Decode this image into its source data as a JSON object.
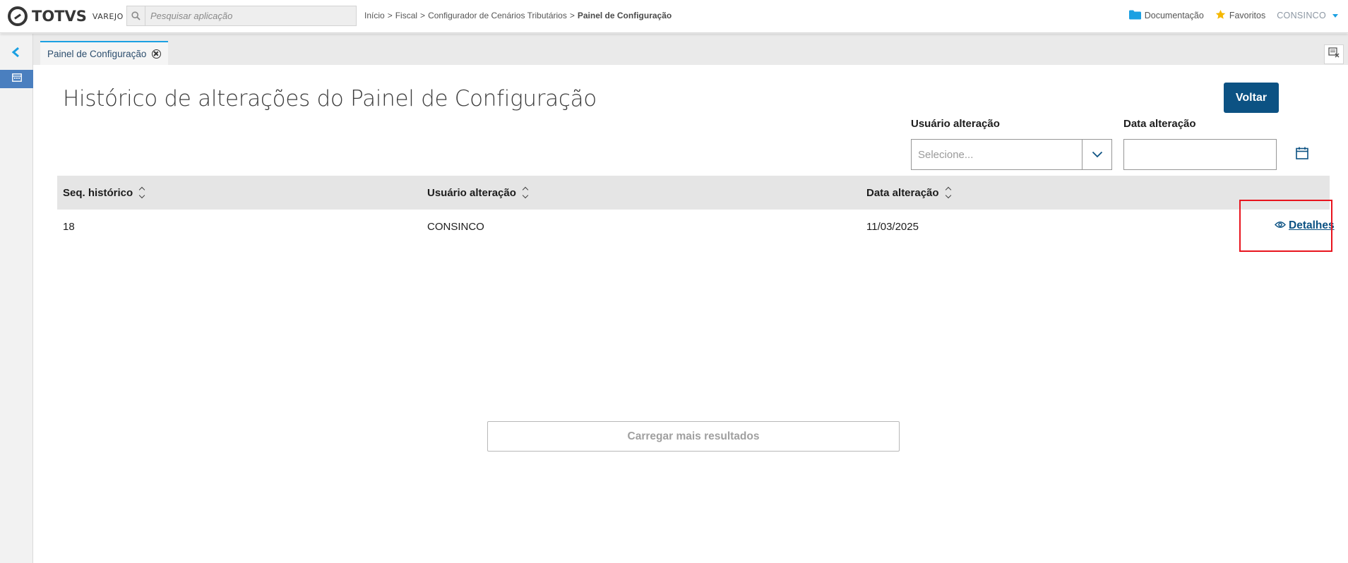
{
  "header": {
    "logo_text": "TOTVS",
    "logo_sub": "VAREJO",
    "search_placeholder": "Pesquisar aplicação",
    "breadcrumb": [
      "Início",
      "Fiscal",
      "Configurador de Cenários Tributários"
    ],
    "breadcrumb_current": "Painel de Configuração",
    "breadcrumb_separator": ">",
    "documentation_label": "Documentação",
    "favorites_label": "Favoritos",
    "user_label": "CONSINCO",
    "icons": {
      "search": "search-icon",
      "documentation": "folder-icon",
      "favorites": "star-icon",
      "user_menu": "caret-down-icon"
    }
  },
  "sidebar": {
    "toggle_icon": "chevron-left-icon",
    "active_item_icon": "calendar-grid-icon"
  },
  "tabs": [
    {
      "label": "Painel de Configuração",
      "active": true
    }
  ],
  "page": {
    "title": "Histórico de alterações do Painel de Configuração",
    "back_button": "Voltar",
    "filters": {
      "user_label": "Usuário alteração",
      "user_placeholder": "Selecione...",
      "date_label": "Data alteração",
      "date_value": ""
    },
    "table": {
      "columns": [
        "Seq. histórico",
        "Usuário alteração",
        "Data alteração"
      ],
      "rows": [
        {
          "seq": "18",
          "user": "CONSINCO",
          "date": "11/03/2025",
          "action": "Detalhes"
        }
      ]
    },
    "load_more": "Carregar mais resultados"
  },
  "colors": {
    "primary": "#0c5283",
    "accent": "#1ba0e2",
    "highlight": "#e8141e",
    "star": "#f5b800",
    "table_header_bg": "#e5e5e5"
  }
}
